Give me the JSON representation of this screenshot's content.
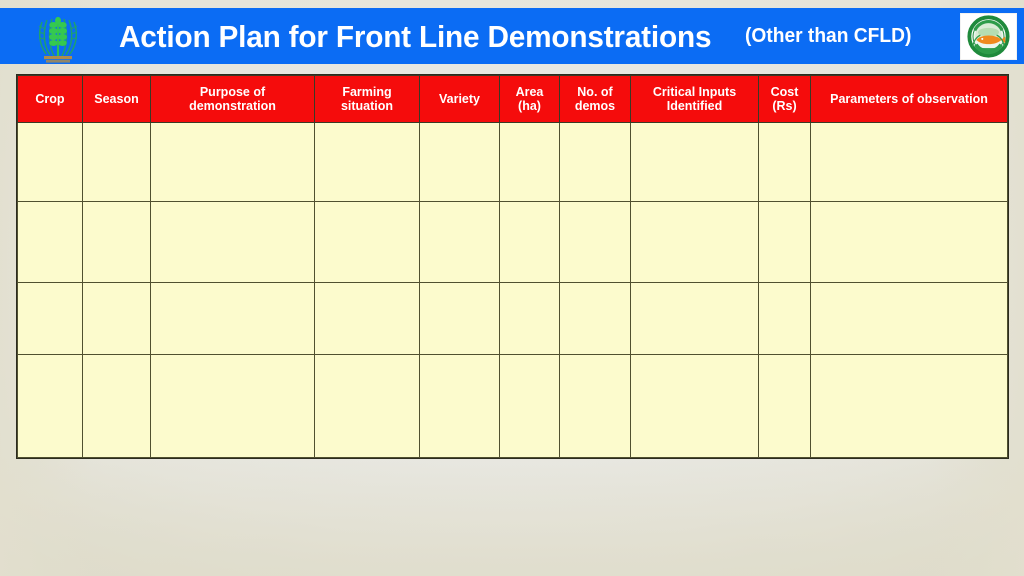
{
  "slide": {
    "background_color": "#e9e9e4",
    "accent_blue": "#0b6cf4",
    "header_red": "#f50c0c",
    "cell_yellow": "#fcfbcd"
  },
  "title_bar": {
    "main_title": "Action Plan for Front Line Demonstrations",
    "subtitle": "(Other than CFLD)",
    "left_logo": "icar-wheat-emblem-icon",
    "right_logo": "kvk-circular-emblem-icon"
  },
  "table": {
    "columns": [
      {
        "key": "crop",
        "label": "Crop"
      },
      {
        "key": "season",
        "label": "Season"
      },
      {
        "key": "purpose",
        "label": "Purpose of\ndemonstration"
      },
      {
        "key": "farming",
        "label": "Farming\nsituation"
      },
      {
        "key": "variety",
        "label": "Variety"
      },
      {
        "key": "area",
        "label": "Area\n(ha)"
      },
      {
        "key": "demos",
        "label": "No. of\ndemos"
      },
      {
        "key": "inputs",
        "label": "Critical Inputs\nIdentified"
      },
      {
        "key": "cost",
        "label": "Cost\n(Rs)"
      },
      {
        "key": "params",
        "label": "Parameters of observation"
      }
    ],
    "rows": [
      {
        "crop": "",
        "season": "",
        "purpose": "",
        "farming": "",
        "variety": "",
        "area": "",
        "demos": "",
        "inputs": "",
        "cost": "",
        "params": ""
      },
      {
        "crop": "",
        "season": "",
        "purpose": "",
        "farming": "",
        "variety": "",
        "area": "",
        "demos": "",
        "inputs": "",
        "cost": "",
        "params": ""
      },
      {
        "crop": "",
        "season": "",
        "purpose": "",
        "farming": "",
        "variety": "",
        "area": "",
        "demos": "",
        "inputs": "",
        "cost": "",
        "params": ""
      },
      {
        "crop": "",
        "season": "",
        "purpose": "",
        "farming": "",
        "variety": "",
        "area": "",
        "demos": "",
        "inputs": "",
        "cost": "",
        "params": ""
      }
    ]
  }
}
